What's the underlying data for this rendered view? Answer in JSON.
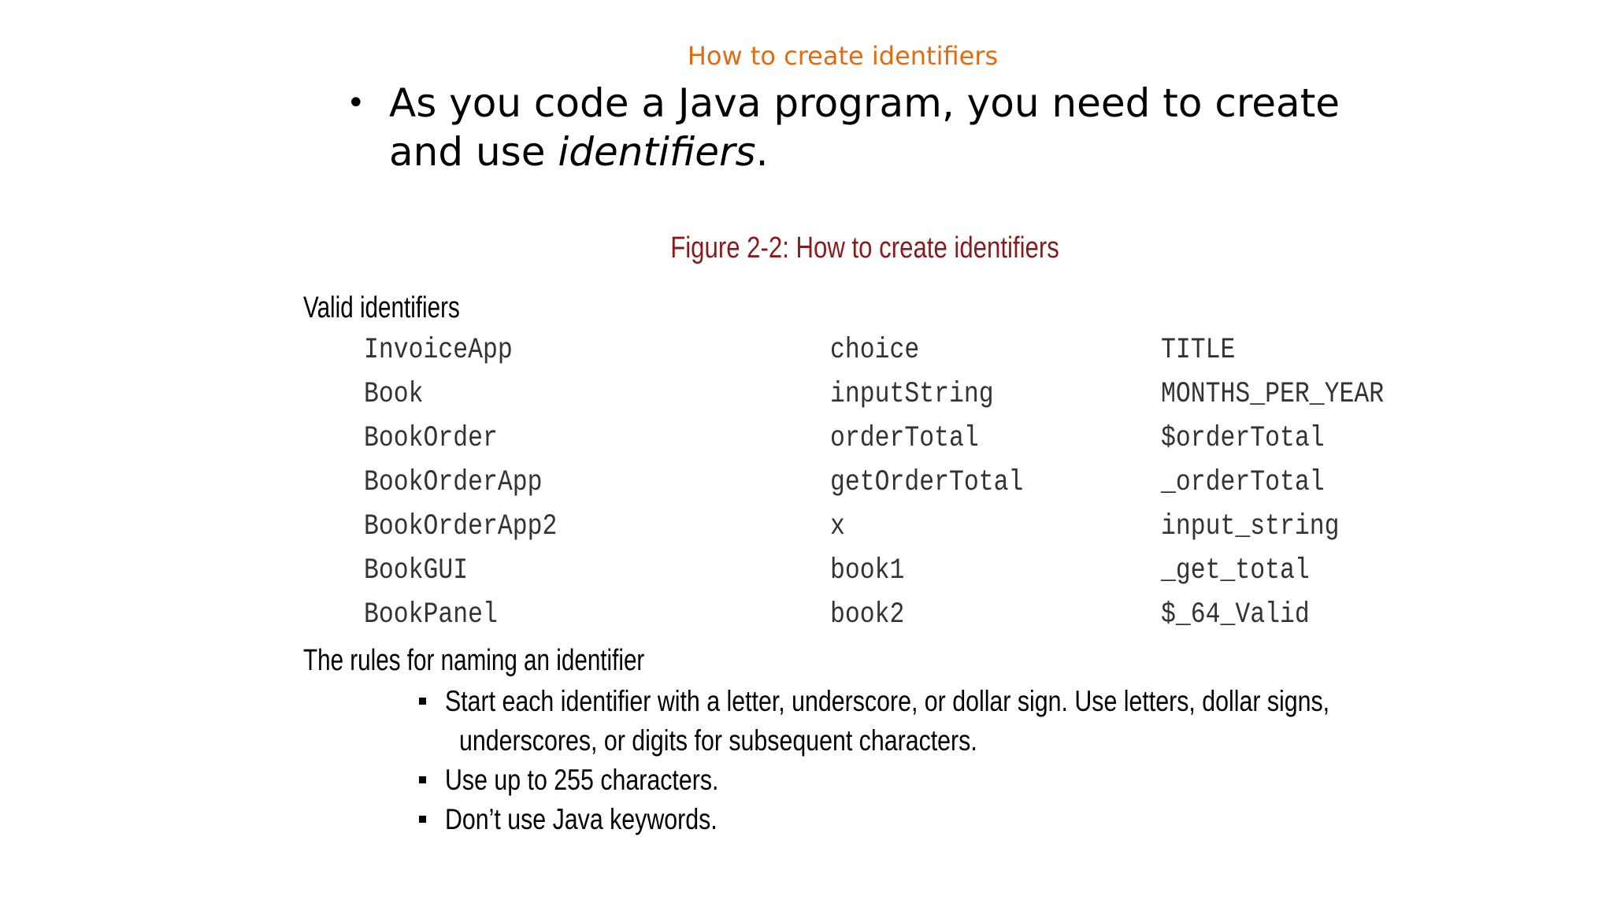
{
  "slide": {
    "title": "How to create identifiers",
    "bullet_prefix": "As you code a Java program, you need to create and use ",
    "bullet_emphasis": "identifiers",
    "bullet_suffix": "."
  },
  "figure": {
    "title": "Figure 2-2: How to create identifiers",
    "valid_heading": "Valid identifiers",
    "identifiers": [
      [
        "InvoiceApp",
        "choice",
        "TITLE"
      ],
      [
        "Book",
        "inputString",
        "MONTHS_PER_YEAR"
      ],
      [
        "BookOrder",
        "orderTotal",
        "$orderTotal"
      ],
      [
        "BookOrderApp",
        "getOrderTotal",
        "_orderTotal"
      ],
      [
        "BookOrderApp2",
        "x",
        "input_string"
      ],
      [
        "BookGUI",
        "book1",
        "_get_total"
      ],
      [
        "BookPanel",
        "book2",
        "$_64_Valid"
      ]
    ],
    "rules_heading": "The rules for naming an identifier",
    "rules": [
      {
        "line1": "Start each identifier with a letter, underscore, or dollar sign. Use letters, dollar signs,",
        "line2": "underscores, or digits for subsequent characters."
      },
      {
        "line1": "Use up to 255 characters.",
        "line2": ""
      },
      {
        "line1": "Don’t use Java keywords.",
        "line2": ""
      }
    ]
  },
  "colors": {
    "slide_title": "#e26b12",
    "figure_title": "#8b1a1a"
  }
}
